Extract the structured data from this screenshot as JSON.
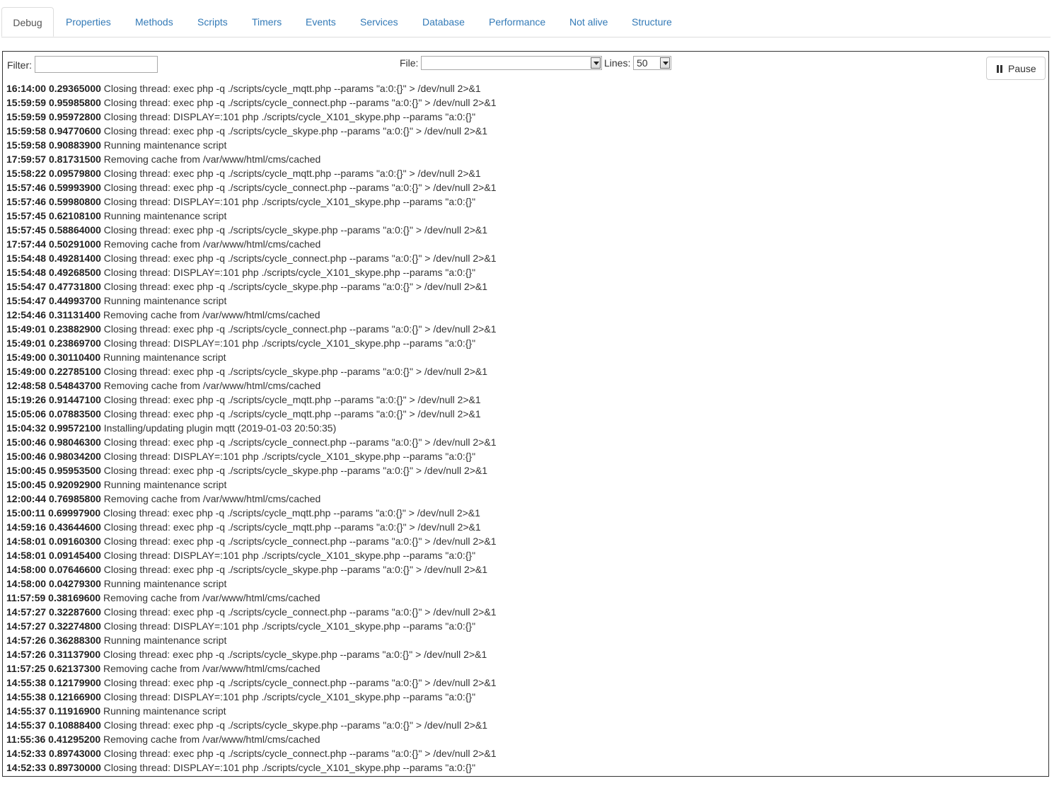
{
  "tabs": [
    {
      "label": "Debug",
      "active": true
    },
    {
      "label": "Properties"
    },
    {
      "label": "Methods"
    },
    {
      "label": "Scripts"
    },
    {
      "label": "Timers"
    },
    {
      "label": "Events"
    },
    {
      "label": "Services"
    },
    {
      "label": "Database"
    },
    {
      "label": "Performance"
    },
    {
      "label": "Not alive"
    },
    {
      "label": "Structure"
    }
  ],
  "toolbar": {
    "filter_label": "Filter:",
    "filter_value": "",
    "file_label": "File:",
    "file_value": "",
    "lines_label": "Lines:",
    "lines_value": "50",
    "pause_label": "Pause"
  },
  "log": [
    {
      "time": "16:14:00",
      "val": "0.29365000",
      "msg": "Closing thread: exec php -q ./scripts/cycle_mqtt.php --params \"a:0:{}\" > /dev/null 2>&1"
    },
    {
      "time": "15:59:59",
      "val": "0.95985800",
      "msg": "Closing thread: exec php -q ./scripts/cycle_connect.php --params \"a:0:{}\" > /dev/null 2>&1"
    },
    {
      "time": "15:59:59",
      "val": "0.95972800",
      "msg": "Closing thread: DISPLAY=:101 php ./scripts/cycle_X101_skype.php --params \"a:0:{}\""
    },
    {
      "time": "15:59:58",
      "val": "0.94770600",
      "msg": "Closing thread: exec php -q ./scripts/cycle_skype.php --params \"a:0:{}\" > /dev/null 2>&1"
    },
    {
      "time": "15:59:58",
      "val": "0.90883900",
      "msg": "Running maintenance script"
    },
    {
      "time": "17:59:57",
      "val": "0.81731500",
      "msg": "Removing cache from /var/www/html/cms/cached"
    },
    {
      "time": "15:58:22",
      "val": "0.09579800",
      "msg": "Closing thread: exec php -q ./scripts/cycle_mqtt.php --params \"a:0:{}\" > /dev/null 2>&1"
    },
    {
      "time": "15:57:46",
      "val": "0.59993900",
      "msg": "Closing thread: exec php -q ./scripts/cycle_connect.php --params \"a:0:{}\" > /dev/null 2>&1"
    },
    {
      "time": "15:57:46",
      "val": "0.59980800",
      "msg": "Closing thread: DISPLAY=:101 php ./scripts/cycle_X101_skype.php --params \"a:0:{}\""
    },
    {
      "time": "15:57:45",
      "val": "0.62108100",
      "msg": "Running maintenance script"
    },
    {
      "time": "15:57:45",
      "val": "0.58864000",
      "msg": "Closing thread: exec php -q ./scripts/cycle_skype.php --params \"a:0:{}\" > /dev/null 2>&1"
    },
    {
      "time": "17:57:44",
      "val": "0.50291000",
      "msg": "Removing cache from /var/www/html/cms/cached"
    },
    {
      "time": "15:54:48",
      "val": "0.49281400",
      "msg": "Closing thread: exec php -q ./scripts/cycle_connect.php --params \"a:0:{}\" > /dev/null 2>&1"
    },
    {
      "time": "15:54:48",
      "val": "0.49268500",
      "msg": "Closing thread: DISPLAY=:101 php ./scripts/cycle_X101_skype.php --params \"a:0:{}\""
    },
    {
      "time": "15:54:47",
      "val": "0.47731800",
      "msg": "Closing thread: exec php -q ./scripts/cycle_skype.php --params \"a:0:{}\" > /dev/null 2>&1"
    },
    {
      "time": "15:54:47",
      "val": "0.44993700",
      "msg": "Running maintenance script"
    },
    {
      "time": "12:54:46",
      "val": "0.31131400",
      "msg": "Removing cache from /var/www/html/cms/cached"
    },
    {
      "time": "15:49:01",
      "val": "0.23882900",
      "msg": "Closing thread: exec php -q ./scripts/cycle_connect.php --params \"a:0:{}\" > /dev/null 2>&1"
    },
    {
      "time": "15:49:01",
      "val": "0.23869700",
      "msg": "Closing thread: DISPLAY=:101 php ./scripts/cycle_X101_skype.php --params \"a:0:{}\""
    },
    {
      "time": "15:49:00",
      "val": "0.30110400",
      "msg": "Running maintenance script"
    },
    {
      "time": "15:49:00",
      "val": "0.22785100",
      "msg": "Closing thread: exec php -q ./scripts/cycle_skype.php --params \"a:0:{}\" > /dev/null 2>&1"
    },
    {
      "time": "12:48:58",
      "val": "0.54843700",
      "msg": "Removing cache from /var/www/html/cms/cached"
    },
    {
      "time": "15:19:26",
      "val": "0.91447100",
      "msg": "Closing thread: exec php -q ./scripts/cycle_mqtt.php --params \"a:0:{}\" > /dev/null 2>&1"
    },
    {
      "time": "15:05:06",
      "val": "0.07883500",
      "msg": "Closing thread: exec php -q ./scripts/cycle_mqtt.php --params \"a:0:{}\" > /dev/null 2>&1"
    },
    {
      "time": "15:04:32",
      "val": "0.99572100",
      "msg": "Installing/updating plugin mqtt (2019-01-03 20:50:35)"
    },
    {
      "time": "15:00:46",
      "val": "0.98046300",
      "msg": "Closing thread: exec php -q ./scripts/cycle_connect.php --params \"a:0:{}\" > /dev/null 2>&1"
    },
    {
      "time": "15:00:46",
      "val": "0.98034200",
      "msg": "Closing thread: DISPLAY=:101 php ./scripts/cycle_X101_skype.php --params \"a:0:{}\""
    },
    {
      "time": "15:00:45",
      "val": "0.95953500",
      "msg": "Closing thread: exec php -q ./scripts/cycle_skype.php --params \"a:0:{}\" > /dev/null 2>&1"
    },
    {
      "time": "15:00:45",
      "val": "0.92092900",
      "msg": "Running maintenance script"
    },
    {
      "time": "12:00:44",
      "val": "0.76985800",
      "msg": "Removing cache from /var/www/html/cms/cached"
    },
    {
      "time": "15:00:11",
      "val": "0.69997900",
      "msg": "Closing thread: exec php -q ./scripts/cycle_mqtt.php --params \"a:0:{}\" > /dev/null 2>&1"
    },
    {
      "time": "14:59:16",
      "val": "0.43644600",
      "msg": "Closing thread: exec php -q ./scripts/cycle_mqtt.php --params \"a:0:{}\" > /dev/null 2>&1"
    },
    {
      "time": "14:58:01",
      "val": "0.09160300",
      "msg": "Closing thread: exec php -q ./scripts/cycle_connect.php --params \"a:0:{}\" > /dev/null 2>&1"
    },
    {
      "time": "14:58:01",
      "val": "0.09145400",
      "msg": "Closing thread: DISPLAY=:101 php ./scripts/cycle_X101_skype.php --params \"a:0:{}\""
    },
    {
      "time": "14:58:00",
      "val": "0.07646600",
      "msg": "Closing thread: exec php -q ./scripts/cycle_skype.php --params \"a:0:{}\" > /dev/null 2>&1"
    },
    {
      "time": "14:58:00",
      "val": "0.04279300",
      "msg": "Running maintenance script"
    },
    {
      "time": "11:57:59",
      "val": "0.38169600",
      "msg": "Removing cache from /var/www/html/cms/cached"
    },
    {
      "time": "14:57:27",
      "val": "0.32287600",
      "msg": "Closing thread: exec php -q ./scripts/cycle_connect.php --params \"a:0:{}\" > /dev/null 2>&1"
    },
    {
      "time": "14:57:27",
      "val": "0.32274800",
      "msg": "Closing thread: DISPLAY=:101 php ./scripts/cycle_X101_skype.php --params \"a:0:{}\""
    },
    {
      "time": "14:57:26",
      "val": "0.36288300",
      "msg": "Running maintenance script"
    },
    {
      "time": "14:57:26",
      "val": "0.31137900",
      "msg": "Closing thread: exec php -q ./scripts/cycle_skype.php --params \"a:0:{}\" > /dev/null 2>&1"
    },
    {
      "time": "11:57:25",
      "val": "0.62137300",
      "msg": "Removing cache from /var/www/html/cms/cached"
    },
    {
      "time": "14:55:38",
      "val": "0.12179900",
      "msg": "Closing thread: exec php -q ./scripts/cycle_connect.php --params \"a:0:{}\" > /dev/null 2>&1"
    },
    {
      "time": "14:55:38",
      "val": "0.12166900",
      "msg": "Closing thread: DISPLAY=:101 php ./scripts/cycle_X101_skype.php --params \"a:0:{}\""
    },
    {
      "time": "14:55:37",
      "val": "0.11916900",
      "msg": "Running maintenance script"
    },
    {
      "time": "14:55:37",
      "val": "0.10888400",
      "msg": "Closing thread: exec php -q ./scripts/cycle_skype.php --params \"a:0:{}\" > /dev/null 2>&1"
    },
    {
      "time": "11:55:36",
      "val": "0.41295200",
      "msg": "Removing cache from /var/www/html/cms/cached"
    },
    {
      "time": "14:52:33",
      "val": "0.89743000",
      "msg": "Closing thread: exec php -q ./scripts/cycle_connect.php --params \"a:0:{}\" > /dev/null 2>&1"
    },
    {
      "time": "14:52:33",
      "val": "0.89730000",
      "msg": "Closing thread: DISPLAY=:101 php ./scripts/cycle_X101_skype.php --params \"a:0:{}\""
    }
  ]
}
